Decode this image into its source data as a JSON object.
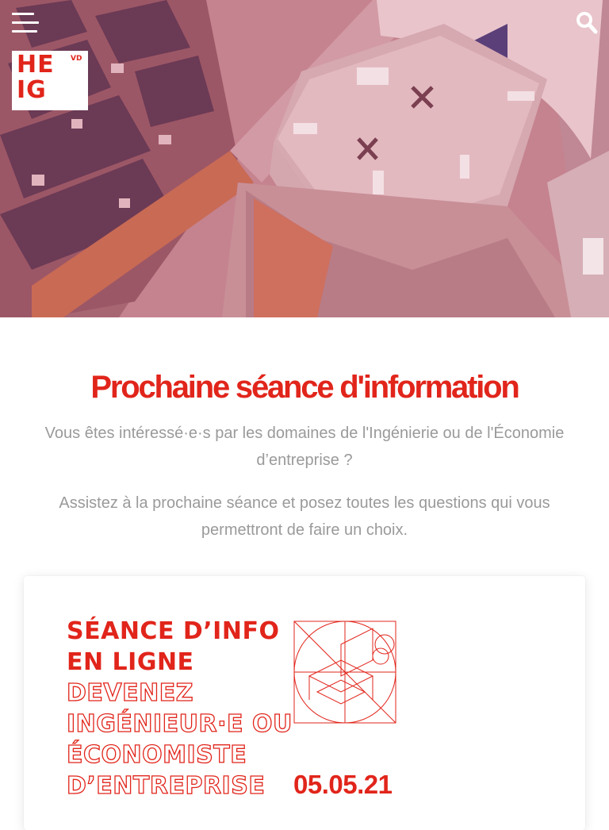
{
  "header": {
    "menu_icon": "hamburger-menu-icon",
    "search_icon": "search-icon",
    "logo": {
      "letters_line1": "HE",
      "letters_line2": "IG",
      "superscript": "VD"
    },
    "overlay_color": "#b4505f"
  },
  "info": {
    "title": "Prochaine séance d'information",
    "paragraph1": "Vous êtes intéressé·e·s par les domaines de l'Ingénierie ou de l'Économie d’entreprise ?",
    "paragraph2": "Assistez à la prochaine séance et posez toutes les questions qui vous permettront de faire un choix."
  },
  "card": {
    "line1": "Séance d’info",
    "line2": "en ligne",
    "line3": "Devenez",
    "line4": "ingénieur·e ou",
    "line5": "économiste",
    "line6": "d’entreprise",
    "date": "05.05.21"
  },
  "colors": {
    "accent": "#e1251b",
    "muted_text": "#9a9a9a"
  }
}
